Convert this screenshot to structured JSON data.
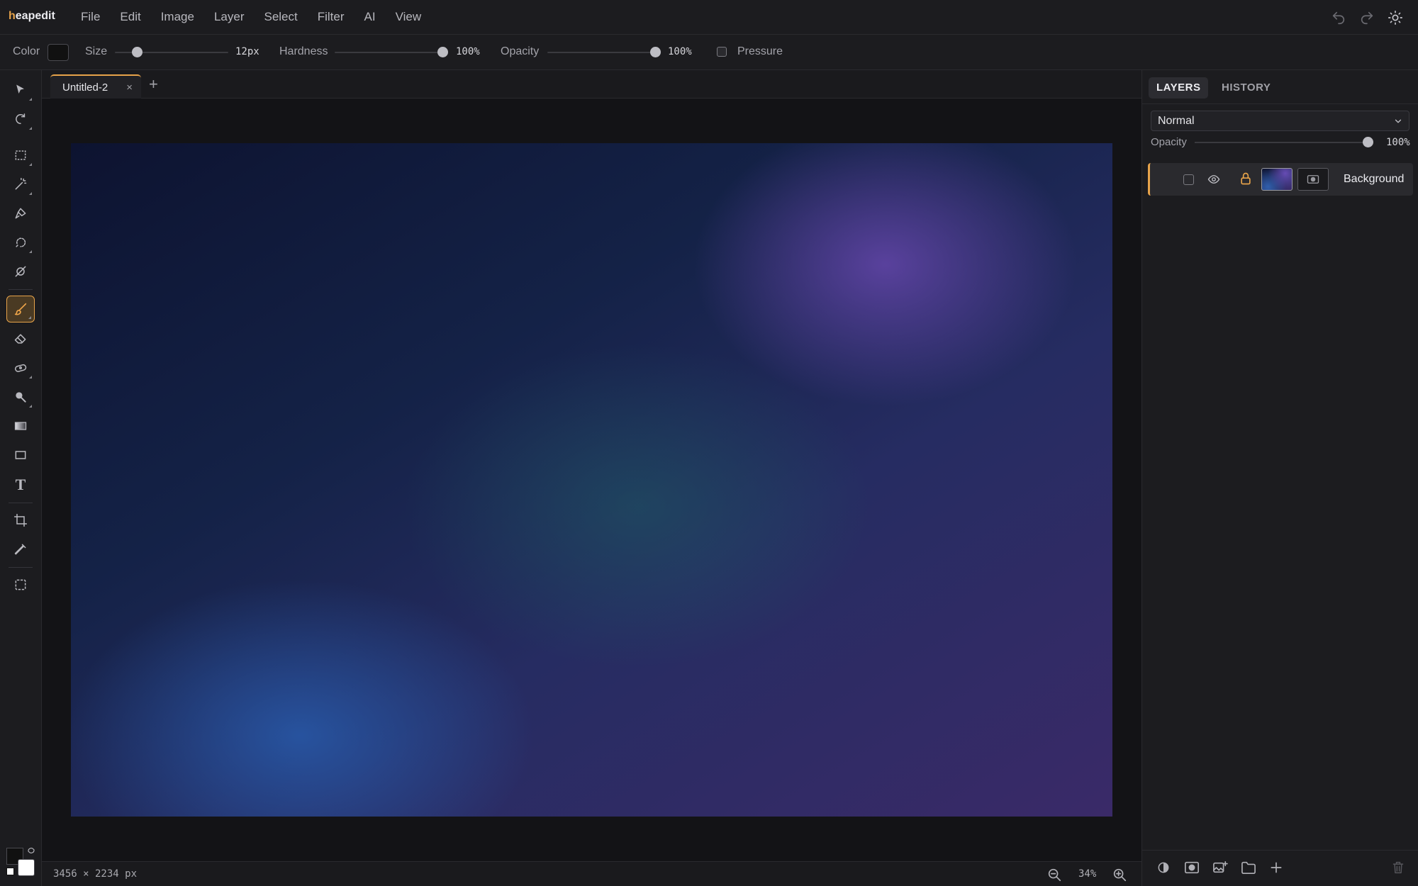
{
  "app": {
    "logo_first": "h",
    "logo_rest": "eapedit"
  },
  "menu": {
    "items": [
      "File",
      "Edit",
      "Image",
      "Layer",
      "Select",
      "Filter",
      "AI",
      "View"
    ]
  },
  "header_icons": [
    "undo-icon",
    "redo-icon",
    "theme-toggle-icon"
  ],
  "options": {
    "color_label": "Color",
    "color_value": "#111111",
    "size_label": "Size",
    "size_value": "12px",
    "size_fraction": 0.17,
    "hardness_label": "Hardness",
    "hardness_value": "100%",
    "hardness_fraction": 1.0,
    "opacity_label": "Opacity",
    "opacity_value": "100%",
    "opacity_fraction": 1.0,
    "pressure_label": "Pressure",
    "pressure_checked": false
  },
  "tools": [
    {
      "name": "move-tool",
      "icon": "cursor-icon",
      "active": false
    },
    {
      "name": "lasso-tool",
      "icon": "lasso-icon",
      "active": false
    },
    {
      "name": "marquee-tool",
      "icon": "marquee-icon",
      "active": false
    },
    {
      "name": "magic-wand-tool",
      "icon": "magic-wand-icon",
      "active": false
    },
    {
      "name": "pen-tool",
      "icon": "pen-icon",
      "active": false
    },
    {
      "name": "quick-selection-tool",
      "icon": "quick-selection-icon",
      "active": false
    },
    {
      "name": "object-select-tool",
      "icon": "object-select-icon",
      "active": false
    },
    {
      "name": "brush-tool",
      "icon": "brush-icon",
      "active": true
    },
    {
      "name": "eraser-tool",
      "icon": "eraser-icon",
      "active": false
    },
    {
      "name": "healing-tool",
      "icon": "bandage-icon",
      "active": false
    },
    {
      "name": "dodge-tool",
      "icon": "dodge-icon",
      "active": false
    },
    {
      "name": "gradient-tool",
      "icon": "gradient-icon",
      "active": false
    },
    {
      "name": "shape-tool",
      "icon": "rectangle-icon",
      "active": false
    },
    {
      "name": "text-tool",
      "icon": "text-icon",
      "active": false
    },
    {
      "name": "crop-tool",
      "icon": "crop-icon",
      "active": false
    },
    {
      "name": "eyedropper-tool",
      "icon": "eyedropper-icon",
      "active": false
    },
    {
      "name": "frame-tool",
      "icon": "frame-icon",
      "active": false
    }
  ],
  "colors": {
    "foreground": "#111111",
    "background": "#ffffff",
    "accent": "#e7a34a"
  },
  "document": {
    "tab_title": "Untitled-2",
    "close_glyph": "×",
    "new_tab_glyph": "+",
    "size_text": "3456 × 2234 px",
    "zoom_text": "34%"
  },
  "panel": {
    "tabs": [
      "LAYERS",
      "HISTORY"
    ],
    "active_tab": "LAYERS",
    "blend_mode": "Normal",
    "opacity_label": "Opacity",
    "opacity_value": "100%",
    "opacity_fraction": 1.0,
    "layers": [
      {
        "name": "Background",
        "visible": true,
        "locked": true,
        "selected": true
      }
    ],
    "footer_icons": [
      "adjustment-icon",
      "mask-icon",
      "add-image-icon",
      "folder-icon",
      "add-layer-icon",
      "trash-icon"
    ]
  }
}
